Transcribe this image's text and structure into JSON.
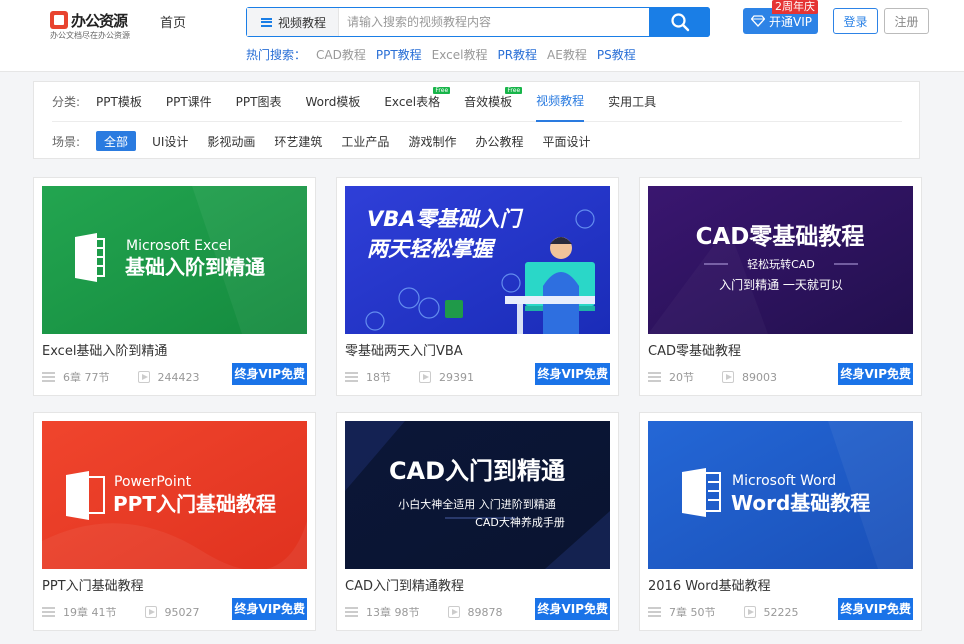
{
  "header": {
    "logo_text": "办公资源",
    "logo_slogan": "办公文档尽在办公资源",
    "nav_home": "首页",
    "search_category": "视频教程",
    "search_placeholder": "请输入搜索的视频教程内容",
    "hot_label": "热门搜索：",
    "hot_items": [
      "CAD教程",
      "PPT教程",
      "Excel教程",
      "PR教程",
      "AE教程",
      "PS教程"
    ],
    "vip_label": "开通VIP",
    "vip_badge": "2周年庆",
    "login_label": "登录",
    "register_label": "注册"
  },
  "filter": {
    "category_label": "分类:",
    "categories": [
      "PPT模板",
      "PPT课件",
      "PPT图表",
      "Word模板",
      "Excel表格",
      "音效模板",
      "视频教程",
      "实用工具"
    ],
    "free_tag": "Free",
    "scene_label": "场景:",
    "scenes": [
      "全部",
      "UI设计",
      "影视动画",
      "环艺建筑",
      "工业产品",
      "游戏制作",
      "办公教程",
      "平面设计"
    ]
  },
  "courses": [
    {
      "title": "Excel基础入阶到精通",
      "lessons": "6章 77节",
      "views": "244423",
      "badge": "终身VIP免费",
      "thumb": {
        "line1": "Microsoft Excel",
        "line2": "基础入阶到精通",
        "icon_letter": "X"
      }
    },
    {
      "title": "零基础两天入门VBA",
      "lessons": "18节",
      "views": "29391",
      "badge": "终身VIP免费",
      "thumb": {
        "line1": "VBA零基础入门",
        "line2": "两天轻松掌握"
      }
    },
    {
      "title": "CAD零基础教程",
      "lessons": "20节",
      "views": "89003",
      "badge": "终身VIP免费",
      "thumb": {
        "line1": "CAD零基础教程",
        "line2": "轻松玩转CAD",
        "line3": "入门到精通 一天就可以"
      }
    },
    {
      "title": "PPT入门基础教程",
      "lessons": "19章 41节",
      "views": "95027",
      "badge": "终身VIP免费",
      "thumb": {
        "line1": "PowerPoint",
        "line2": "PPT入门基础教程",
        "icon_letter": "P"
      }
    },
    {
      "title": "CAD入门到精通教程",
      "lessons": "13章 98节",
      "views": "89878",
      "badge": "终身VIP免费",
      "thumb": {
        "line1": "CAD入门到精通",
        "line2": "小白大神全适用 入门进阶到精通",
        "line3": "CAD大神养成手册"
      }
    },
    {
      "title": "2016 Word基础教程",
      "lessons": "7章 50节",
      "views": "52225",
      "badge": "终身VIP免费",
      "thumb": {
        "line1": "Microsoft Word",
        "line2": "Word基础教程",
        "icon_letter": "W"
      }
    }
  ],
  "colors": {
    "accent": "#1a7ee6",
    "vip_badge": "#e53434",
    "free_tag": "#18b54a",
    "excel_green": "#1f9a49",
    "ppt_red": "#ec3d2a",
    "word_blue": "#1f5cc4"
  }
}
